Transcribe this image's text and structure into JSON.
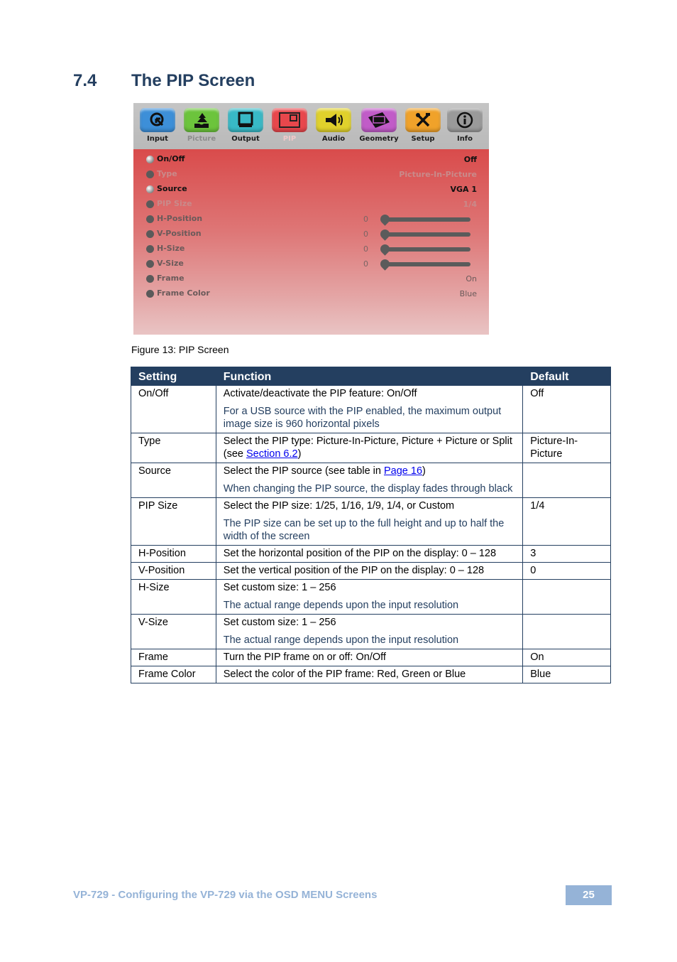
{
  "section": {
    "number": "7.4",
    "title": "The PIP Screen"
  },
  "osd": {
    "tabs": [
      {
        "label": "Input",
        "icon": "input-cursor-icon",
        "color": "#3d8fd8",
        "state": "normal"
      },
      {
        "label": "Picture",
        "icon": "picture-tree-icon",
        "color": "#6cc43c",
        "state": "dim"
      },
      {
        "label": "Output",
        "icon": "output-tv-icon",
        "color": "#38b9c6",
        "state": "normal"
      },
      {
        "label": "PIP",
        "icon": "pip-window-icon",
        "color": "#e8474c",
        "state": "active"
      },
      {
        "label": "Audio",
        "icon": "audio-megaphone-icon",
        "color": "#e0d12c",
        "state": "normal"
      },
      {
        "label": "Geometry",
        "icon": "geometry-icon",
        "color": "#c15cc8",
        "state": "normal"
      },
      {
        "label": "Setup",
        "icon": "setup-tools-icon",
        "color": "#f0a22a",
        "state": "normal"
      },
      {
        "label": "Info",
        "icon": "info-icon",
        "color": "#9a9a9a",
        "state": "normal"
      }
    ],
    "rows": [
      {
        "name": "On/Off",
        "value": "Off",
        "state": "on"
      },
      {
        "name": "Type",
        "value": "Picture-In-Picture",
        "state": "muted"
      },
      {
        "name": "Source",
        "value": "VGA 1",
        "state": "on"
      },
      {
        "name": "PIP Size",
        "value": "1/4",
        "state": "muted"
      },
      {
        "name": "H-Position",
        "value": "0",
        "state": "slider",
        "fraction": 0
      },
      {
        "name": "V-Position",
        "value": "0",
        "state": "slider",
        "fraction": 0
      },
      {
        "name": "H-Size",
        "value": "0",
        "state": "slider",
        "fraction": 0
      },
      {
        "name": "V-Size",
        "value": "0",
        "state": "slider",
        "fraction": 0
      },
      {
        "name": "Frame",
        "value": "On",
        "state": "normal"
      },
      {
        "name": "Frame Color",
        "value": "Blue",
        "state": "normal"
      }
    ]
  },
  "figure_caption": "Figure 13: PIP Screen",
  "table": {
    "headers": [
      "Setting",
      "Function",
      "Default"
    ],
    "rows": [
      {
        "setting": "On/Off",
        "function": "Activate/deactivate the PIP feature: On/Off",
        "note": "For a USB source with the PIP enabled, the maximum output image size is 960 horizontal pixels",
        "default": "Off"
      },
      {
        "setting": "Type",
        "function_pre": "Select the PIP type: Picture-In-Picture, Picture + Picture or Split (see ",
        "link": "Section 6.2",
        "function_post": ")",
        "default": "Picture-In-Picture"
      },
      {
        "setting": "Source",
        "function_pre": "Select the PIP source (see table in ",
        "link": "Page 16",
        "function_post": ")",
        "note": "When changing the PIP source, the display fades through black",
        "default": ""
      },
      {
        "setting": "PIP Size",
        "function": "Select the PIP size: 1/25, 1/16, 1/9, 1/4, or Custom",
        "note": "The PIP size can be set up to the full height and up to half the width of the screen",
        "default": "1/4"
      },
      {
        "setting": "H-Position",
        "function": "Set the horizontal position of the PIP on the display: 0 – 128",
        "default": "3"
      },
      {
        "setting": "V-Position",
        "function": "Set the vertical position of the PIP on the display: 0 – 128",
        "default": "0"
      },
      {
        "setting": "H-Size",
        "function": "Set custom size: 1 – 256",
        "note": "The actual range depends upon the input resolution",
        "default": ""
      },
      {
        "setting": "V-Size",
        "function": "Set custom size: 1 – 256",
        "note": "The actual range depends upon the input resolution",
        "default": ""
      },
      {
        "setting": "Frame",
        "function": "Turn the PIP frame on or off: On/Off",
        "default": "On"
      },
      {
        "setting": "Frame Color",
        "function": "Select the color of the PIP frame: Red, Green or Blue",
        "default": "Blue"
      }
    ]
  },
  "footer": {
    "text": "VP-729 - Configuring the VP-729 via the OSD MENU Screens",
    "page": "25"
  }
}
